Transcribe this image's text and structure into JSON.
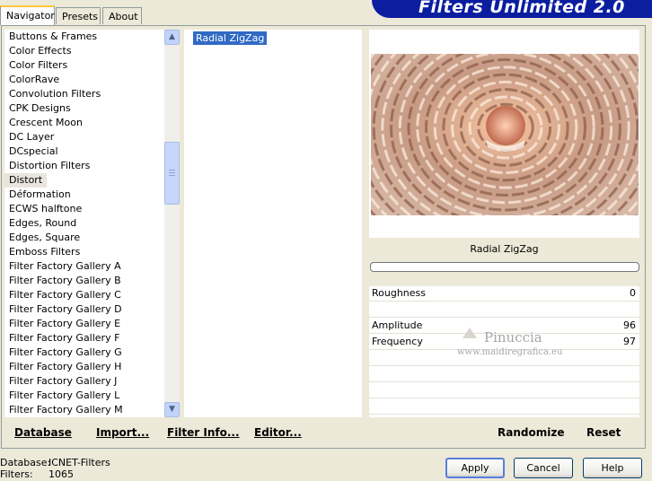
{
  "tabs": [
    {
      "label": "Navigator",
      "active": true
    },
    {
      "label": "Presets",
      "active": false
    },
    {
      "label": "About",
      "active": false
    }
  ],
  "banner": {
    "title": "Filters Unlimited 2.0"
  },
  "categories": {
    "items": [
      "Buttons & Frames",
      "Color Effects",
      "Color Filters",
      "ColorRave",
      "Convolution Filters",
      "CPK Designs",
      "Crescent Moon",
      "DC Layer",
      "DCspecial",
      "Distortion Filters",
      "Distort",
      "Déformation",
      "ECWS halftone",
      "Edges, Round",
      "Edges, Square",
      "Emboss Filters",
      "Filter Factory Gallery A",
      "Filter Factory Gallery B",
      "Filter Factory Gallery C",
      "Filter Factory Gallery D",
      "Filter Factory Gallery E",
      "Filter Factory Gallery F",
      "Filter Factory Gallery G",
      "Filter Factory Gallery H",
      "Filter Factory Gallery J",
      "Filter Factory Gallery L",
      "Filter Factory Gallery M"
    ],
    "selected": "Distort"
  },
  "filters": {
    "items": [
      "Radial ZigZag"
    ],
    "selected": "Radial ZigZag"
  },
  "preview": {
    "filter_name": "Radial ZigZag"
  },
  "params": [
    {
      "name": "Roughness",
      "value": "0"
    },
    {
      "name": "",
      "value": ""
    },
    {
      "name": "Amplitude",
      "value": "96"
    },
    {
      "name": "Frequency",
      "value": "97"
    }
  ],
  "watermark": {
    "title": "Pinuccia",
    "url": "www.maidiregrafica.eu"
  },
  "toolbar": {
    "database": "Database",
    "import": "Import...",
    "filter_info": "Filter Info...",
    "editor": "Editor...",
    "randomize": "Randomize",
    "reset": "Reset"
  },
  "status": {
    "database_label": "Database:",
    "database_value": "ICNET-Filters",
    "filters_label": "Filters:",
    "filters_value": "1065"
  },
  "buttons": {
    "apply": "Apply",
    "cancel": "Cancel",
    "help": "Help"
  },
  "colors": {
    "banner": "#0b1ea0",
    "selection": "#316ac5",
    "tab_accent": "#ffc83c"
  }
}
